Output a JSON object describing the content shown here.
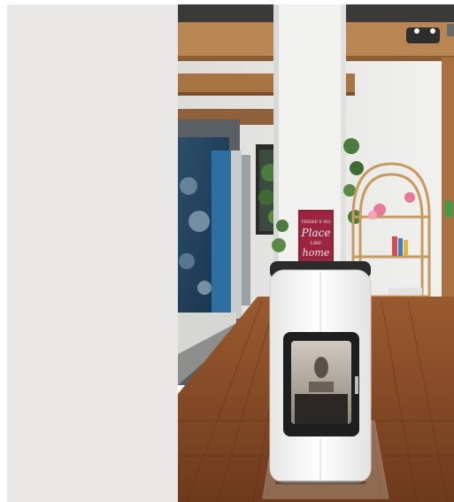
{
  "scene": {
    "sign": {
      "line1": "THERE'S NO",
      "line2": "Place",
      "line3": "LIKE",
      "line4": "home"
    }
  }
}
